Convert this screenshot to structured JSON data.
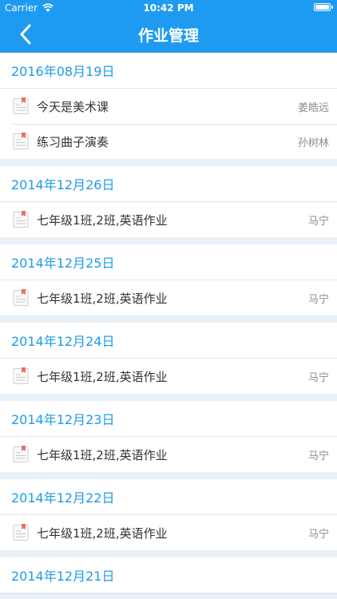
{
  "status_bar": {
    "carrier": "Carrier",
    "time": "10:42 PM",
    "battery_level": 1.0
  },
  "nav": {
    "title": "作业管理",
    "back_icon": "chevron-left-icon"
  },
  "colors": {
    "accent": "#1e9bf0",
    "date_text": "#1e9be8",
    "background": "#e9f0f6",
    "icon_flag": "#ee6b6b"
  },
  "sections": [
    {
      "date": "2016年08月19日",
      "items": [
        {
          "title": "今天是美术课",
          "author": "姜皓远"
        },
        {
          "title": "练习曲子演奏",
          "author": "孙树林"
        }
      ]
    },
    {
      "date": "2014年12月26日",
      "items": [
        {
          "title": "七年级1班,2班,英语作业",
          "author": "马宁"
        }
      ]
    },
    {
      "date": "2014年12月25日",
      "items": [
        {
          "title": "七年级1班,2班,英语作业",
          "author": "马宁"
        }
      ]
    },
    {
      "date": "2014年12月24日",
      "items": [
        {
          "title": "七年级1班,2班,英语作业",
          "author": "马宁"
        }
      ]
    },
    {
      "date": "2014年12月23日",
      "items": [
        {
          "title": "七年级1班,2班,英语作业",
          "author": "马宁"
        }
      ]
    },
    {
      "date": "2014年12月22日",
      "items": [
        {
          "title": "七年级1班,2班,英语作业",
          "author": "马宁"
        }
      ]
    },
    {
      "date": "2014年12月21日",
      "items": []
    }
  ]
}
